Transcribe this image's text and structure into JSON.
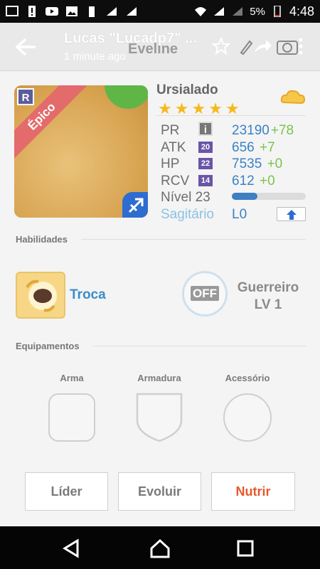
{
  "status": {
    "battery_percent": "5%",
    "time": "4:48"
  },
  "header": {
    "title": "Lucas \"Lucadp7\" ...",
    "subtitle": "1 minute ago",
    "behind_title": "Eveline"
  },
  "card": {
    "name": "Ursialado",
    "rarity": "Épico",
    "rarity_badge": "R",
    "stars": 5,
    "stats": [
      {
        "label": "PR",
        "value": "23190",
        "bonus": "+78"
      },
      {
        "label": "ATK",
        "level": "20",
        "value": "656",
        "bonus": "+7"
      },
      {
        "label": "HP",
        "level": "22",
        "value": "7535",
        "bonus": "+0"
      },
      {
        "label": "RCV",
        "level": "14",
        "value": "612",
        "bonus": "+0"
      }
    ],
    "level_label": "Nível 23",
    "xp_fraction": 0.35,
    "constellation": "Sagitário",
    "constellation_level": "L0"
  },
  "skills": {
    "heading": "Habilidades",
    "active_name": "Troca",
    "leader_state": "OFF",
    "leader_name": "Guerreiro",
    "leader_level": "LV 1"
  },
  "equipment": {
    "heading": "Equipamentos",
    "weapon": "Arma",
    "armor": "Armadura",
    "accessory": "Acessório"
  },
  "buttons": {
    "leader": "Líder",
    "evolve": "Evoluir",
    "feed": "Nutrir"
  },
  "colors": {
    "accent_blue": "#3a82c4",
    "bonus_green": "#7dc24f",
    "feed_orange": "#e5582a",
    "star": "#f6b91a"
  }
}
